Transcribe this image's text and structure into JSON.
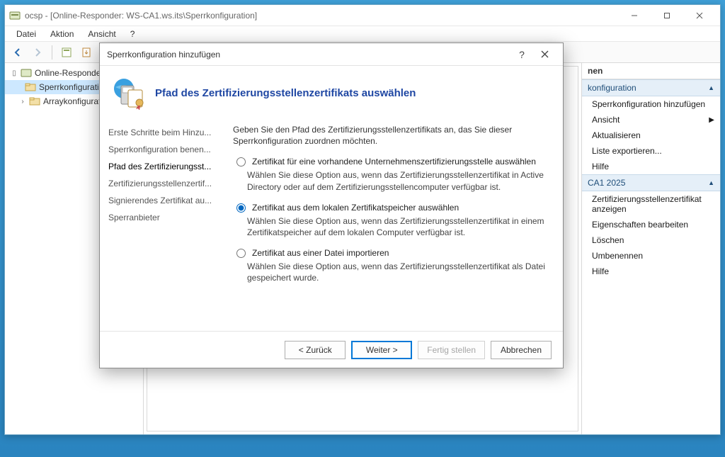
{
  "window": {
    "title": "ocsp - [Online-Responder: WS-CA1.ws.its\\Sperrkonfiguration]"
  },
  "menubar": {
    "file": "Datei",
    "action": "Aktion",
    "view": "Ansicht",
    "help": "?"
  },
  "tree": {
    "root": "Online-Responder: WS",
    "node_sperrkonf": "Sperrkonfiguration",
    "node_arraykonf": "Arraykonfiguration"
  },
  "actions": {
    "header": "nen",
    "section1": {
      "title": "konfiguration"
    },
    "items1": {
      "add": "Sperrkonfiguration hinzufügen",
      "view": "Ansicht",
      "refresh": "Aktualisieren",
      "export": "Liste exportieren...",
      "help": "Hilfe"
    },
    "section2": {
      "title": "CA1 2025"
    },
    "items2": {
      "showCert": "Zertifizierungsstellenzertifikat anzeigen",
      "editProps": "Eigenschaften bearbeiten",
      "delete": "Löschen",
      "rename": "Umbenennen",
      "help": "Hilfe"
    }
  },
  "dialog": {
    "title": "Sperrkonfiguration hinzufügen",
    "heading": "Pfad des Zertifizierungsstellenzertifikats auswählen",
    "steps": {
      "s1": "Erste Schritte beim Hinzu...",
      "s2": "Sperrkonfiguration benen...",
      "s3": "Pfad des Zertifizierungsst...",
      "s4": "Zertifizierungsstellenzertif...",
      "s5": "Signierendes Zertifikat au...",
      "s6": "Sperranbieter"
    },
    "intro": "Geben Sie den Pfad des Zertifizierungsstellenzertifikats an, das Sie dieser Sperrkonfiguration zuordnen möchten.",
    "opt1": {
      "label": "Zertifikat für eine vorhandene Unternehmenszertifizierungsstelle auswählen",
      "desc": "Wählen Sie diese Option aus, wenn das Zertifizierungsstellenzertifikat in Active Directory oder auf dem Zertifizierungsstellencomputer verfügbar ist."
    },
    "opt2": {
      "label": "Zertifikat aus dem lokalen Zertifikatspeicher auswählen",
      "desc": "Wählen Sie diese Option aus, wenn das Zertifizierungsstellenzertifikat in einem Zertifikatspeicher auf dem lokalen Computer verfügbar ist."
    },
    "opt3": {
      "label": "Zertifikat aus einer Datei importieren",
      "desc": "Wählen Sie diese Option aus, wenn das Zertifizierungsstellenzertifikat als Datei gespeichert wurde."
    },
    "buttons": {
      "back": "< Zurück",
      "next": "Weiter >",
      "finish": "Fertig stellen",
      "cancel": "Abbrechen"
    }
  }
}
